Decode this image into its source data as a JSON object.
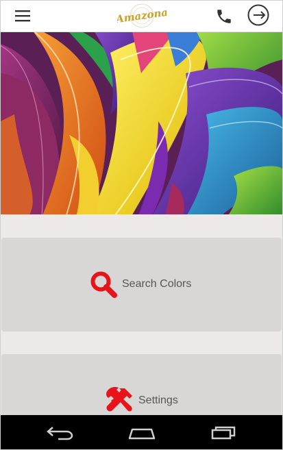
{
  "app": {
    "logo_text": "Amazona"
  },
  "header": {
    "menu_icon": "hamburger-menu-icon",
    "call_icon": "phone-icon",
    "logout_icon": "logout-icon"
  },
  "carousel": {
    "slide_count": 4,
    "active_index": 0
  },
  "tiles": [
    {
      "label": "Search Colors",
      "icon": "search-icon",
      "icon_color": "#e8141b"
    },
    {
      "label": "Settings",
      "icon": "tools-icon",
      "icon_color": "#e8141b"
    }
  ],
  "navbar": {
    "back_icon": "back-icon",
    "home_icon": "home-icon",
    "recents_icon": "recent-apps-icon"
  },
  "colors": {
    "accent": "#e8141b",
    "logo_gold": "#c9a227",
    "tile_bg": "#d9d7d6",
    "page_bg": "#ece9e8"
  }
}
